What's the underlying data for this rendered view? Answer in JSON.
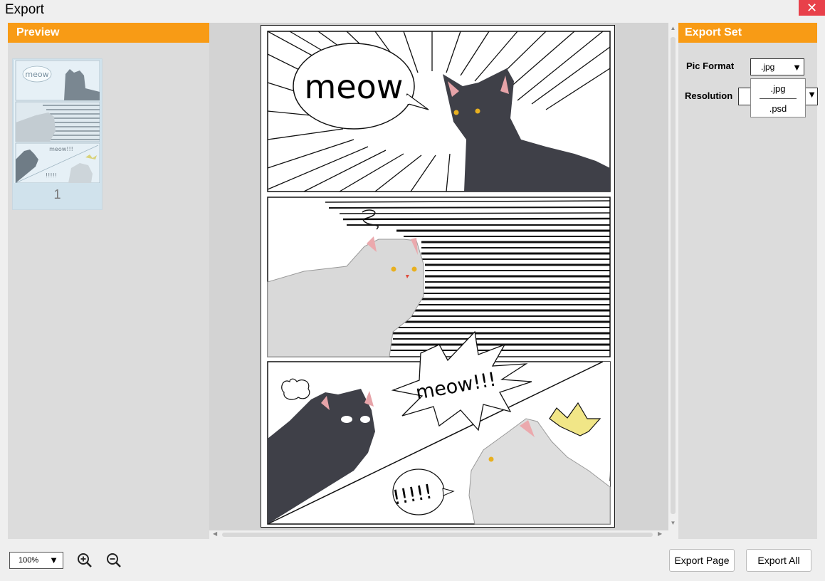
{
  "window": {
    "title": "Export",
    "close_glyph": "✕"
  },
  "preview_panel": {
    "header": "Preview",
    "thumbnail": {
      "page_number": "1",
      "bubble_text": "meow",
      "bubble_text_2": "meow!!!",
      "bubble_text_3": "!!!!!"
    }
  },
  "comic_page": {
    "panel1_bubble": "meow",
    "panel3_bubble_shout": "meow!!!",
    "panel3_bubble_exclaim": "!!!!!"
  },
  "export_settings": {
    "header": "Export Set",
    "pic_format_label": "Pic  Format",
    "pic_format_value": ".jpg",
    "resolution_label": "Resolution",
    "resolution_value": "",
    "format_options": [
      ".jpg",
      ".psd"
    ]
  },
  "toolbar": {
    "zoom_value": "100%",
    "export_page_label": "Export Page",
    "export_all_label": "Export All"
  },
  "colors": {
    "accent": "#f89b15",
    "close_button": "#e8404a",
    "panel_bg": "#dcdcdc",
    "canvas_bg": "#d3d3d3"
  }
}
